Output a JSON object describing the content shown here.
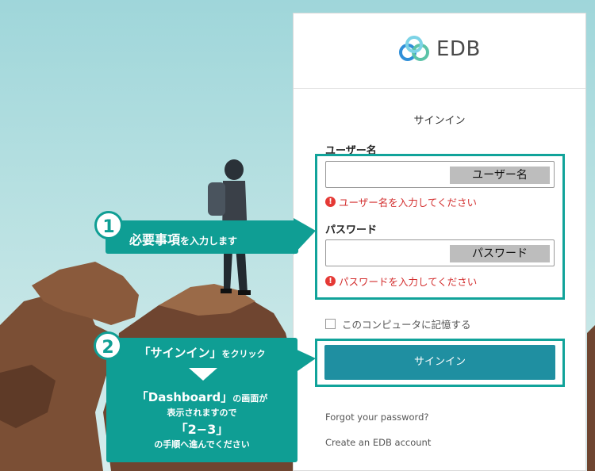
{
  "brand": {
    "name": "EDB"
  },
  "signin": {
    "title": "サインイン",
    "username_label": "ユーザー名",
    "username_placeholder": "ユーザー名",
    "username_error": "ユーザー名を入力してください",
    "password_label": "パスワード",
    "password_placeholder": "パスワード",
    "password_error": "パスワードを入力してください",
    "remember_label": "このコンピュータに記憶する",
    "button_label": "サインイン",
    "forgot_link": "Forgot your password?",
    "create_link": "Create an EDB account"
  },
  "callouts": {
    "step1": {
      "number": "1",
      "bold": "必要事項",
      "rest": "を入力します"
    },
    "step2": {
      "number": "2",
      "line1_bold": "「サインイン」",
      "line1_rest": "をクリック",
      "line2_bold": "「Dashboard」",
      "line2_rest": "の画面が",
      "line3": "表示されますので",
      "line4": "「2−3」",
      "line5": "の手順へ進んでください"
    }
  },
  "colors": {
    "accent": "#1f8fa1",
    "callout": "#0f9e94",
    "error": "#d32f2f"
  }
}
